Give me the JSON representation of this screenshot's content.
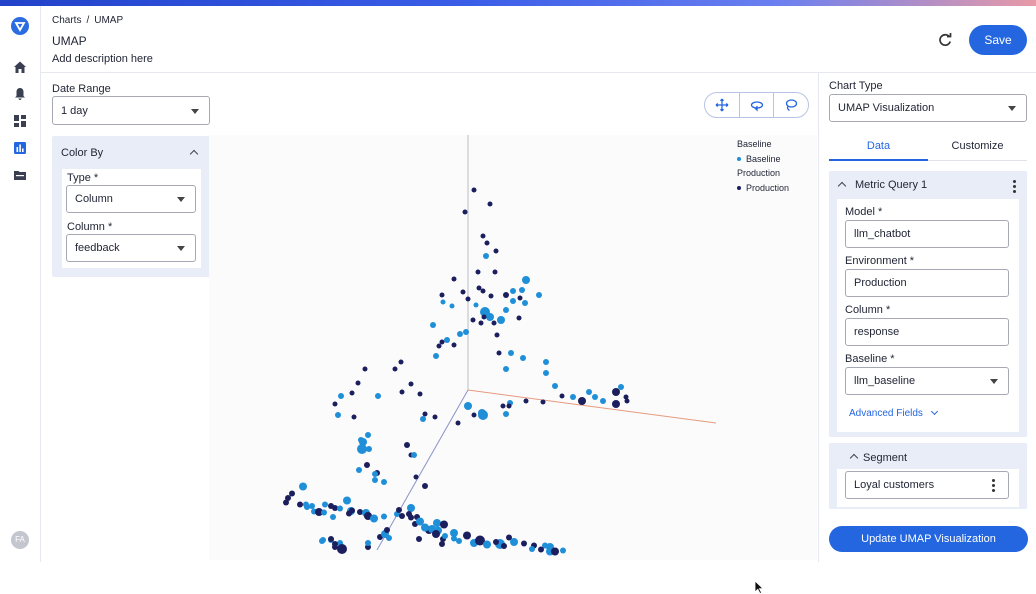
{
  "breadcrumb": {
    "root": "Charts",
    "current": "UMAP"
  },
  "page": {
    "title": "UMAP",
    "description": "Add description here"
  },
  "header": {
    "save_label": "Save"
  },
  "filters": {
    "date_range_label": "Date Range",
    "date_range_value": "1 day"
  },
  "color_by": {
    "title": "Color By",
    "type_label": "Type *",
    "type_value": "Column",
    "column_label": "Column *",
    "column_value": "feedback"
  },
  "legend": {
    "groups": [
      {
        "title": "Baseline",
        "item": "Baseline",
        "color": "#1f8fd8"
      },
      {
        "title": "Production",
        "item": "Production",
        "color": "#1c1f5e"
      }
    ]
  },
  "sidebar": {
    "chart_type_label": "Chart Type",
    "chart_type_value": "UMAP Visualization",
    "tabs": [
      {
        "label": "Data"
      },
      {
        "label": "Customize"
      }
    ],
    "metric_query": {
      "title": "Metric Query 1",
      "model_label": "Model *",
      "model_value": "llm_chatbot",
      "environment_label": "Environment *",
      "environment_value": "Production",
      "column_label": "Column *",
      "column_value": "response",
      "baseline_label": "Baseline *",
      "baseline_value": "llm_baseline",
      "advanced_label": "Advanced Fields"
    },
    "segment": {
      "title": "Segment",
      "value": "Loyal customers"
    },
    "update_label": "Update UMAP Visualization"
  },
  "user": {
    "initials": "FA"
  },
  "colors": {
    "accent": "#2466e0",
    "baseline": "#1f8fd8",
    "production": "#1c1f5e",
    "panel": "#e8edf8"
  }
}
